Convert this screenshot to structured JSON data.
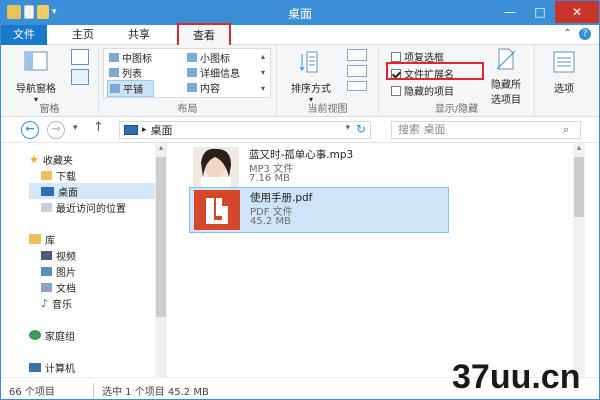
{
  "window": {
    "title": "桌面"
  },
  "tabs": {
    "file": "文件",
    "home": "主页",
    "share": "共享",
    "view": "查看"
  },
  "ribbon": {
    "nav_pane": "导航窗格",
    "pane_group": "窗格",
    "layout": {
      "medium_icons": "中图标",
      "small_icons": "小图标",
      "list": "列表",
      "details": "详细信息",
      "tiles": "平铺",
      "content": "内容"
    },
    "layout_group": "布局",
    "sort_by": "排序方式",
    "current_view_group": "当前视图",
    "item_checkboxes": "项复选框",
    "file_extensions": "文件扩展名",
    "hidden_items": "隐藏的项目",
    "hide_selected_line1": "隐藏所",
    "hide_selected_line2": "选项目",
    "show_hide_group": "显示/隐藏",
    "options": "选项"
  },
  "address": {
    "path": "桌面",
    "search_placeholder": "搜索 桌面"
  },
  "nav": {
    "favorites": "收藏夹",
    "downloads": "下载",
    "desktop": "桌面",
    "recent": "最近访问的位置",
    "libraries": "库",
    "videos": "视频",
    "pictures": "图片",
    "documents": "文档",
    "music": "音乐",
    "homegroup": "家庭组",
    "computer": "计算机"
  },
  "files": [
    {
      "name": "蓝又时-孤单心事.mp3",
      "type": "MP3 文件",
      "size": "7.16 MB"
    },
    {
      "name": "使用手册.pdf",
      "type": "PDF 文件",
      "size": "45.2 MB"
    }
  ],
  "status": {
    "count": "66 个项目",
    "selected": "选中 1 个项目  45.2 MB"
  },
  "watermark": "37uu.cn"
}
